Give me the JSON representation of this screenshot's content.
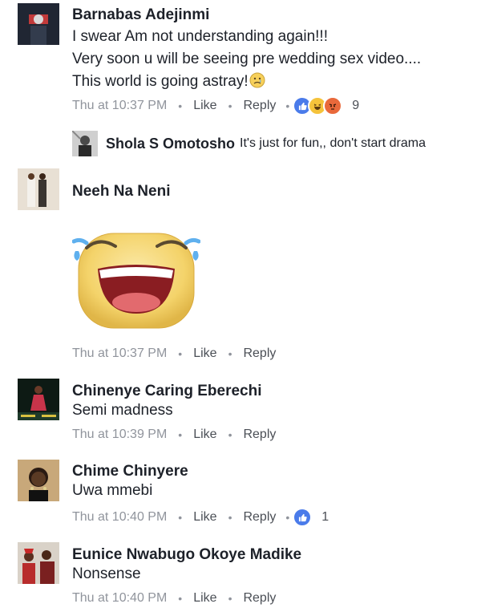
{
  "comments": [
    {
      "name": "Barnabas Adejinmi",
      "lines": [
        "I swear Am not understanding again!!!",
        "Very soon u will be seeing pre wedding sex video....",
        "This world is going astray!"
      ],
      "time": "Thu at 10:37 PM",
      "like": "Like",
      "reply": "Reply",
      "reaction_count": "9",
      "reply_preview": {
        "name": "Shola S Omotosho",
        "text": "It's just for fun,, don't start drama"
      }
    },
    {
      "name": "Neeh Na Neni",
      "sticker": "laughing-crying-face",
      "time": "Thu at 10:37 PM",
      "like": "Like",
      "reply": "Reply"
    },
    {
      "name": "Chinenye Caring Eberechi",
      "text": "Semi madness",
      "time": "Thu at 10:39 PM",
      "like": "Like",
      "reply": "Reply"
    },
    {
      "name": "Chime Chinyere",
      "text": "Uwa mmebi",
      "time": "Thu at 10:40 PM",
      "like": "Like",
      "reply": "Reply",
      "reaction_count": "1"
    },
    {
      "name": "Eunice Nwabugo Okoye Madike",
      "text": "Nonsense",
      "time": "Thu at 10:40 PM",
      "like": "Like",
      "reply": "Reply"
    }
  ],
  "colors": {
    "like_blue": "#4a7bea",
    "meta_gray": "#90949c",
    "text": "#1d2129"
  }
}
